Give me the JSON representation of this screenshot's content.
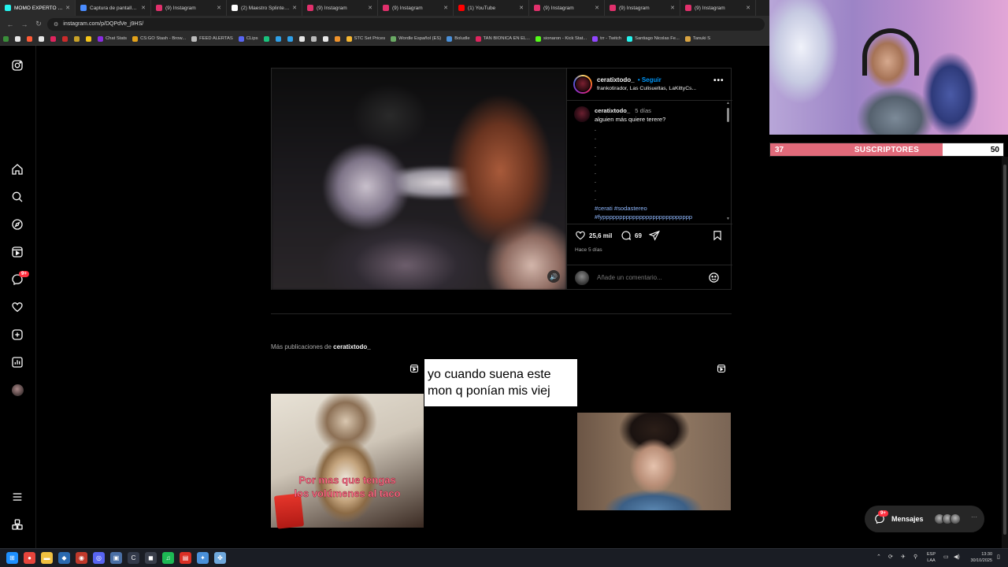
{
  "browser": {
    "tabs": [
      {
        "label": "MOMO EXPERTO EN O",
        "fav": "#25f4ee",
        "active": true
      },
      {
        "label": "Captura de pantalla p",
        "fav": "#4a8cff",
        "active": false
      },
      {
        "label": "(9) Instagram",
        "fav": "#e1306c",
        "active": false
      },
      {
        "label": "(2) Maestro Splinter e",
        "fav": "#ffffff",
        "active": false
      },
      {
        "label": "(9) Instagram",
        "fav": "#e1306c",
        "active": false
      },
      {
        "label": "(9) Instagram",
        "fav": "#e1306c",
        "active": false
      },
      {
        "label": "(1) YouTube",
        "fav": "#ff0000",
        "active": false
      },
      {
        "label": "(9) Instagram",
        "fav": "#e1306c",
        "active": false
      },
      {
        "label": "(9) Instagram",
        "fav": "#e1306c",
        "active": false
      },
      {
        "label": "(9) Instagram",
        "fav": "#e1306c",
        "active": false
      }
    ],
    "tab_close_glyph": "✕",
    "url": "instagram.com/p/DQPdVe_j9HS/",
    "bookmarks": [
      {
        "label": "",
        "color": "#3a8f3a"
      },
      {
        "label": "",
        "color": "#e7e7e7"
      },
      {
        "label": "",
        "color": "#ff5a36"
      },
      {
        "label": "",
        "color": "#e7e7e7"
      },
      {
        "label": "",
        "color": "#e0245e"
      },
      {
        "label": "",
        "color": "#cc2b2b"
      },
      {
        "label": "",
        "color": "#c9a227"
      },
      {
        "label": "",
        "color": "#f5c518"
      },
      {
        "label": "Chat Stats",
        "color": "#8a2be2"
      },
      {
        "label": "CS:GO Stash - Brow...",
        "color": "#e3a21a"
      },
      {
        "label": "FEED ALERTAS",
        "color": "#bbbbbb"
      },
      {
        "label": "CLips",
        "color": "#5865f2"
      },
      {
        "label": "",
        "color": "#19c37d"
      },
      {
        "label": "",
        "color": "#2ea0e8"
      },
      {
        "label": "",
        "color": "#2ea0e8"
      },
      {
        "label": "",
        "color": "#e7e7e7"
      },
      {
        "label": "",
        "color": "#bbbbbb"
      },
      {
        "label": "",
        "color": "#e7e7e7"
      },
      {
        "label": "",
        "color": "#f0932b"
      },
      {
        "label": "STC Set Prices",
        "color": "#f7b731"
      },
      {
        "label": "Wordle Español (ES)",
        "color": "#6aaa64"
      },
      {
        "label": "Boludle",
        "color": "#4a90d9"
      },
      {
        "label": "TAN BIONICA EN EL...",
        "color": "#e0245e"
      },
      {
        "label": "sionaron - Kick Stat...",
        "color": "#53fc18"
      },
      {
        "label": "trr - Twitch",
        "color": "#9146ff"
      },
      {
        "label": "Santiago Nicolas Fe...",
        "color": "#25f4ee"
      },
      {
        "label": "Tanuki S",
        "color": "#d9a441"
      }
    ]
  },
  "post": {
    "username": "ceratixtodo_",
    "follow": "• Seguir",
    "audio": "frankotirador, Las Culisueltas, LaKittyCs...",
    "caption_time": "5 días",
    "caption_text": "alguien más quiere terere?",
    "caption_dots": ".\n.\n.\n.\n.\n.\n.\n.\n.",
    "hashtags_line1": "#cerati #sodastereo",
    "hashtags_line2": "#fyppppppppppppppppppppppppppp",
    "likes": "25,6 mil",
    "comments": "69",
    "posted_ago": "Hace 5 días",
    "comment_placeholder": "Añade un comentario..."
  },
  "more_posts": {
    "prefix": "Más publicaciones de",
    "username": "ceratixtodo_",
    "thumb_cat_text": "Por mas que tengas\nlos volúmenes al taco",
    "thumb_meme_text": "yo cuando suena este\nmon q ponían mis viej"
  },
  "messages": {
    "label": "Mensajes",
    "badge": "9+"
  },
  "nav": {
    "notifications_badge": "9+"
  },
  "stream": {
    "sub_current": "37",
    "sub_goal": "50",
    "sub_label": "SUSCRIPTORES",
    "sub_progress": 0.74,
    "sub_fill_color": "#e06a7a"
  },
  "taskbar": {
    "lang_line1": "ESP",
    "lang_line2": "LAA",
    "time": "13:30",
    "date": "30/10/2025",
    "apps": [
      {
        "glyph": "⊞",
        "color": "#1e90ff"
      },
      {
        "glyph": "●",
        "color": "#e8453c"
      },
      {
        "glyph": "▬",
        "color": "#f0c040"
      },
      {
        "glyph": "◆",
        "color": "#2a6ab0"
      },
      {
        "glyph": "◉",
        "color": "#c0392b"
      },
      {
        "glyph": "◎",
        "color": "#5865f2"
      },
      {
        "glyph": "▣",
        "color": "#4a6fa5"
      },
      {
        "glyph": "C",
        "color": "#333a4a"
      },
      {
        "glyph": "◼",
        "color": "#3a3f4b"
      },
      {
        "glyph": "♫",
        "color": "#1db954"
      },
      {
        "glyph": "▤",
        "color": "#d93025"
      },
      {
        "glyph": "✦",
        "color": "#4a90d9"
      },
      {
        "glyph": "✤",
        "color": "#6fa8dc"
      }
    ]
  }
}
